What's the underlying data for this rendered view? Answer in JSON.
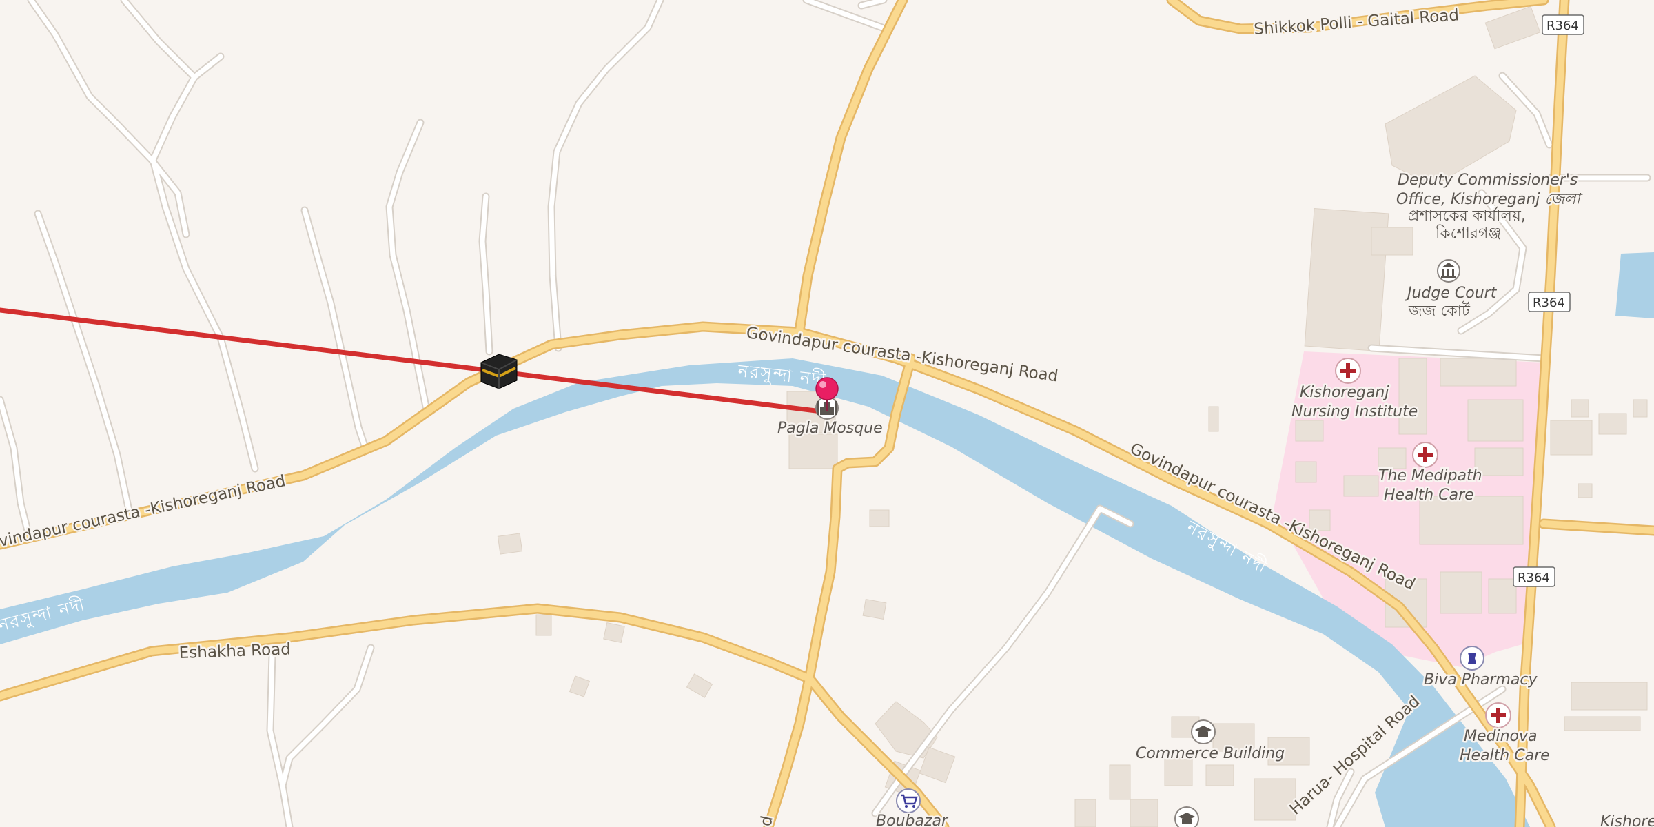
{
  "map": {
    "roads": {
      "govindapur_1": "Govindapur courasta -Kishoreganj Road",
      "govindapur_2": "Govindapur courasta -Kishoreganj Road",
      "govindapur_3": "Govindapur courasta -Kishoreganj Road",
      "govindapur_4": "vindapur courasta -Kishoreganj Road",
      "shikkok": "Shikkok Polli - Gaital Road",
      "eshakha": "Eshakha Road",
      "harua": "Harua- Hospital Road",
      "bottom_fragment": "d"
    },
    "river_labels": [
      "নরসুন্দা নদী",
      "নরসুন্দা নদী",
      "নরসুন্দা নদী"
    ],
    "route_shields": [
      "R364",
      "R364",
      "R364"
    ],
    "pois": {
      "pagla_mosque": "Pagla Mosque",
      "dc_office_line1": "Deputy Commissioner's",
      "dc_office_line2": "Office, Kishoreganj জেলা",
      "dc_office_line3": "প্রশাসকের কার্যালয়,",
      "dc_office_line4": "কিশোরগঞ্জ",
      "judge_court_line1": "Judge Court",
      "judge_court_line2": "জজ কোর্ট",
      "nursing_line1": "Kishoreganj",
      "nursing_line2": "Nursing Institute",
      "medipath_line1": "The Medipath",
      "medipath_line2": "Health Care",
      "biva_pharmacy": "Biva Pharmacy",
      "medinova_line1": "Medinova",
      "medinova_line2": "Health Care",
      "commerce_building": "Commerce Building",
      "boubazar": "Boubazar",
      "kishore_fragment": "Kishore"
    },
    "icons": {
      "mosque_marker": "mosque-icon",
      "kaaba_marker": "kaaba-icon",
      "pin": "location-pin-icon",
      "hospital": "hospital-cross-icon",
      "courthouse": "courthouse-icon",
      "pharmacy": "pharmacy-icon",
      "school": "school-icon",
      "shop": "shopping-cart-icon"
    },
    "colors": {
      "background": "#f8f4f0",
      "water": "#abd0e6",
      "major_road": "#fad98f",
      "road_casing": "#e5b766",
      "minor_road": "#ffffff",
      "hospital_area": "#fcdbe8",
      "qibla_line": "#d32f2f",
      "pin": "#e91e63"
    }
  }
}
